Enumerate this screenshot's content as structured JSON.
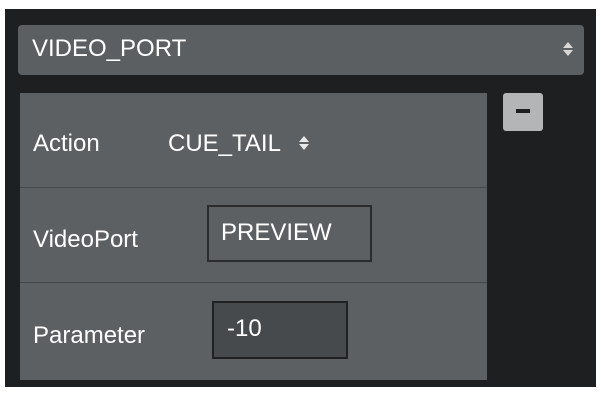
{
  "port_select": {
    "value": "VIDEO_PORT",
    "icon": "updown-arrows-icon"
  },
  "params": {
    "action": {
      "label": "Action",
      "value": "CUE_TAIL",
      "icon": "updown-arrows-icon"
    },
    "videoport": {
      "label": "VideoPort",
      "value": "PREVIEW"
    },
    "parameter": {
      "label": "Parameter",
      "value": "-10"
    }
  },
  "remove_button": {
    "icon": "minus-icon"
  },
  "colors": {
    "panel_background": "#1e1f20",
    "select_background": "#5b5f62",
    "params_background": "#5d6063",
    "input_background": "#474a4c",
    "remove_button_background": "#b4b5b6",
    "text": "#ffffff"
  }
}
